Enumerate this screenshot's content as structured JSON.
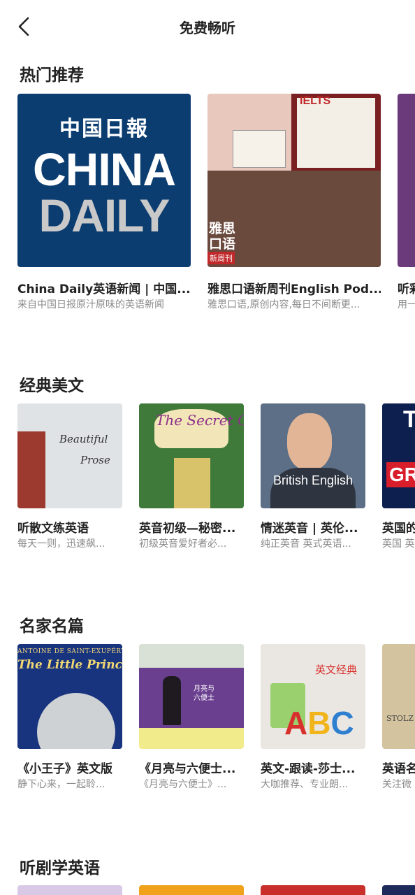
{
  "header": {
    "title": "免费畅听",
    "back_icon": "chevron-left-icon"
  },
  "sections": [
    {
      "title": "热门推荐",
      "items": [
        {
          "title": "China Daily英语新闻 | 中国...",
          "subtitle": "来自中国日报原汁原味的英语新闻",
          "cover": "China Daily",
          "cover_cn": "中国日報",
          "cover_w1": "CHINA",
          "cover_w2": "DAILY"
        },
        {
          "title": "雅思口语新周刊English Pod...",
          "subtitle": "雅思口语,原创内容,每日不间断更...",
          "cover": "IELTS",
          "cover_tag1": "雅思",
          "cover_tag2": "口语",
          "cover_tag3": "新周刊"
        },
        {
          "title": "听彩",
          "subtitle": "用一"
        }
      ]
    },
    {
      "title": "经典美文",
      "items": [
        {
          "title": "听散文练英语",
          "subtitle": "每天一则，迅速飙...",
          "cover_t1": "Beautiful",
          "cover_t2": "Prose"
        },
        {
          "title": "英音初级—秘密...",
          "subtitle": "初级英音爱好者必...",
          "cover_t1": "The Secret Garden"
        },
        {
          "title": "情迷英音 | 英伦...",
          "subtitle": "纯正英音 英式英语...",
          "cover_t1": "British English"
        },
        {
          "title": "英国的",
          "subtitle": "英国 英",
          "cover_t1": "T",
          "cover_t2": "GR"
        }
      ]
    },
    {
      "title": "名家名篇",
      "items": [
        {
          "title": "《小王子》英文版",
          "subtitle": "静下心来，一起聆...",
          "cover_t1": "ANTOINE DE SAINT-EXUPÉRY",
          "cover_t2": "The Little Prince"
        },
        {
          "title": "《月亮与六便士...",
          "subtitle": "《月亮与六便士》...",
          "cover_t1": "月亮与",
          "cover_t2": "六便士"
        },
        {
          "title": "英文-跟读-莎士...",
          "subtitle": "大咖推荐、专业朗...",
          "cover_t1": "英文经典",
          "cover_t2": "ABC"
        },
        {
          "title": "英语名",
          "subtitle": "关注微",
          "cover_t1": "STOLZ"
        }
      ]
    },
    {
      "title": "听剧学英语"
    }
  ]
}
